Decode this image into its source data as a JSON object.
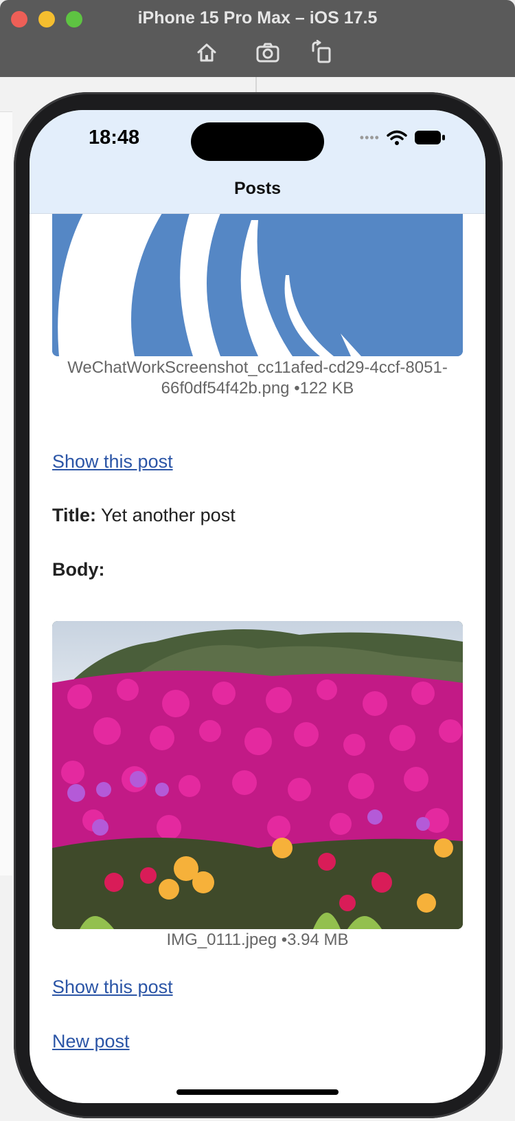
{
  "window": {
    "title": "iPhone 15 Pro Max – iOS 17.5",
    "toolbar": [
      "home-icon",
      "screenshot-icon",
      "rotate-icon"
    ]
  },
  "status_bar": {
    "time": "18:48"
  },
  "nav": {
    "title": "Posts"
  },
  "posts": [
    {
      "attachment": {
        "filename": "WeChatWorkScreenshot_cc11afed-cd29-4ccf-8051-66f0df54f42b.png",
        "size": "•122 KB"
      },
      "show_link": "Show this post"
    },
    {
      "title_label": "Title:",
      "title": "Yet another post",
      "body_label": "Body:",
      "attachment": {
        "filename": "IMG_0111.jpeg",
        "size": "•3.94 MB"
      },
      "show_link": "Show this post"
    }
  ],
  "new_post_link": "New post",
  "colors": {
    "link": "#2b55a6",
    "navbar": "#e3eefb",
    "image_blue": "#5587c5"
  }
}
